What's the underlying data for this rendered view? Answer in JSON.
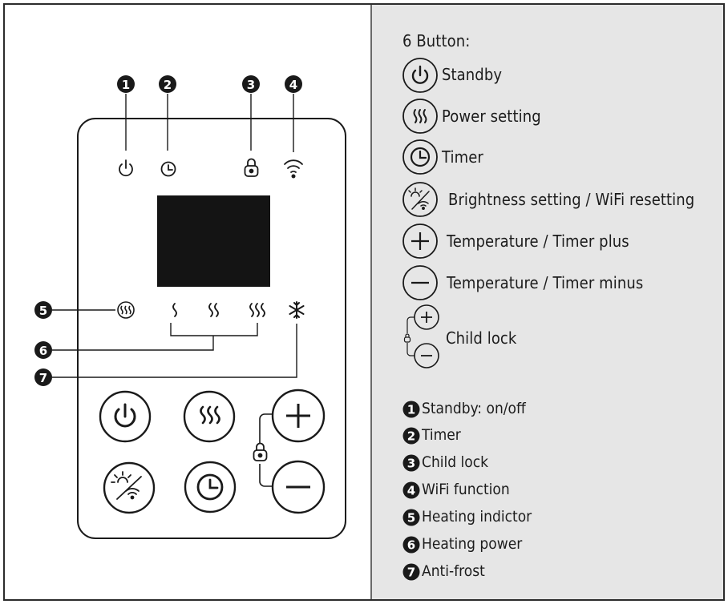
{
  "buttons_header": "6 Button:",
  "buttons": [
    {
      "icon": "power-icon",
      "label": "Standby"
    },
    {
      "icon": "heat-waves-icon",
      "label": "Power setting"
    },
    {
      "icon": "clock-icon",
      "label": "Timer"
    },
    {
      "icon": "brightness-wifi-icon",
      "label": "Brightness setting / WiFi resetting"
    },
    {
      "icon": "plus-icon",
      "label": "Temperature / Timer plus"
    },
    {
      "icon": "minus-icon",
      "label": "Temperature / Timer minus"
    },
    {
      "icon": "child-lock-icon",
      "label": "Child lock"
    }
  ],
  "indicators": [
    {
      "number": "1",
      "label": "Standby: on/off"
    },
    {
      "number": "2",
      "label": "Timer"
    },
    {
      "number": "3",
      "label": "Child lock"
    },
    {
      "number": "4",
      "label": "WiFi function"
    },
    {
      "number": "5",
      "label": "Heating indictor"
    },
    {
      "number": "6",
      "label": "Heating power"
    },
    {
      "number": "7",
      "label": "Anti-frost"
    }
  ]
}
